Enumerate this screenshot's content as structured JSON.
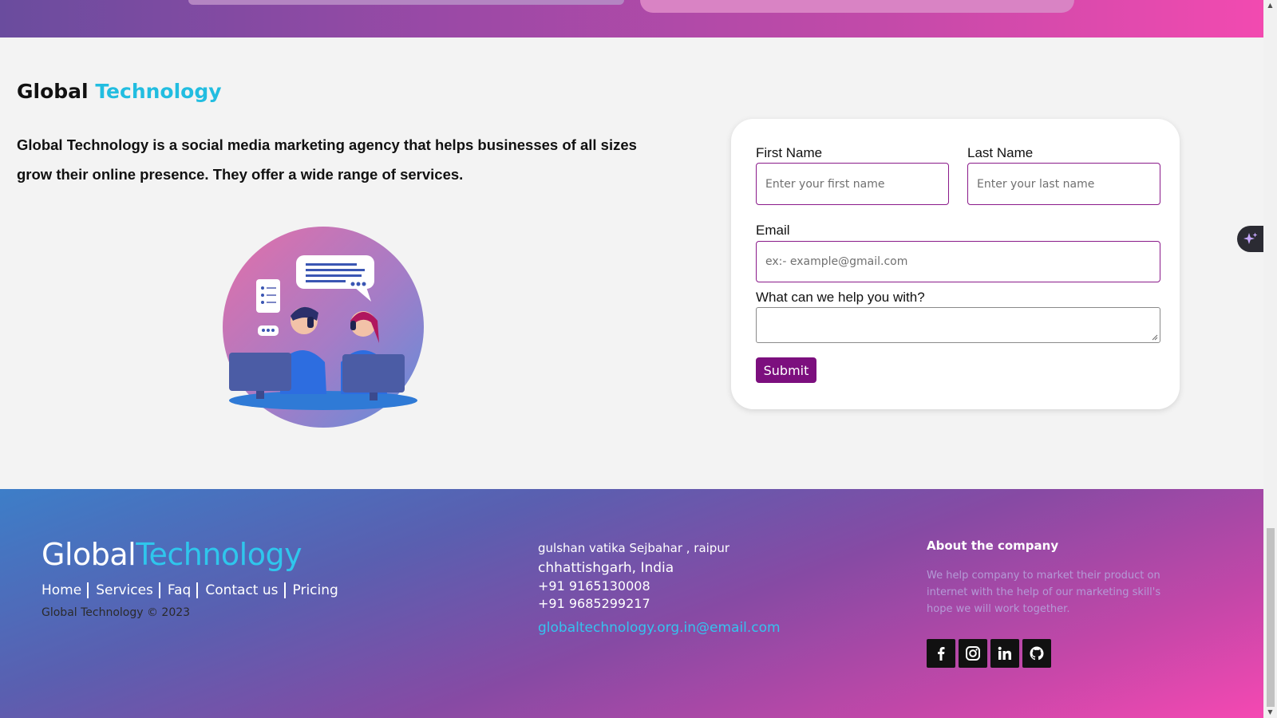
{
  "brand": {
    "part1": "Global",
    "part2": "Technology"
  },
  "intro": {
    "text": "Global Technology is a social media marketing agency that helps businesses of all sizes grow their online presence. They offer a wide range of services."
  },
  "form": {
    "first_name_label": "First Name",
    "first_name_placeholder": "Enter your first name",
    "last_name_label": "Last Name",
    "last_name_placeholder": "Enter your last name",
    "email_label": "Email",
    "email_placeholder": "ex:- example@gmail.com",
    "help_label": "What can we help you with?",
    "submit_label": "Submit"
  },
  "footer": {
    "brand_part1": "Global",
    "brand_part2": "Technology",
    "nav": [
      "Home",
      "Services",
      "Faq",
      "Contact us",
      "Pricing"
    ],
    "copyright": "Global Technology © 2023",
    "address_line1": "gulshan vatika Sejbahar , raipur",
    "address_line2": "chhattishgarh, India",
    "phone1": "+91 9165130008",
    "phone2": "+91 9685299217",
    "email": "globaltechnology.org.in@email.com",
    "about_heading": "About the company",
    "about_text": "We help company to market their product on internet with the help of our marketing skill's hope we will work together.",
    "socials": [
      "facebook-icon",
      "instagram-icon",
      "linkedin-icon",
      "github-icon"
    ]
  },
  "colors": {
    "accent": "#22bde0",
    "button": "#7c0f7e",
    "gradient_start": "#3d7ec8",
    "gradient_end": "#f548b2"
  }
}
